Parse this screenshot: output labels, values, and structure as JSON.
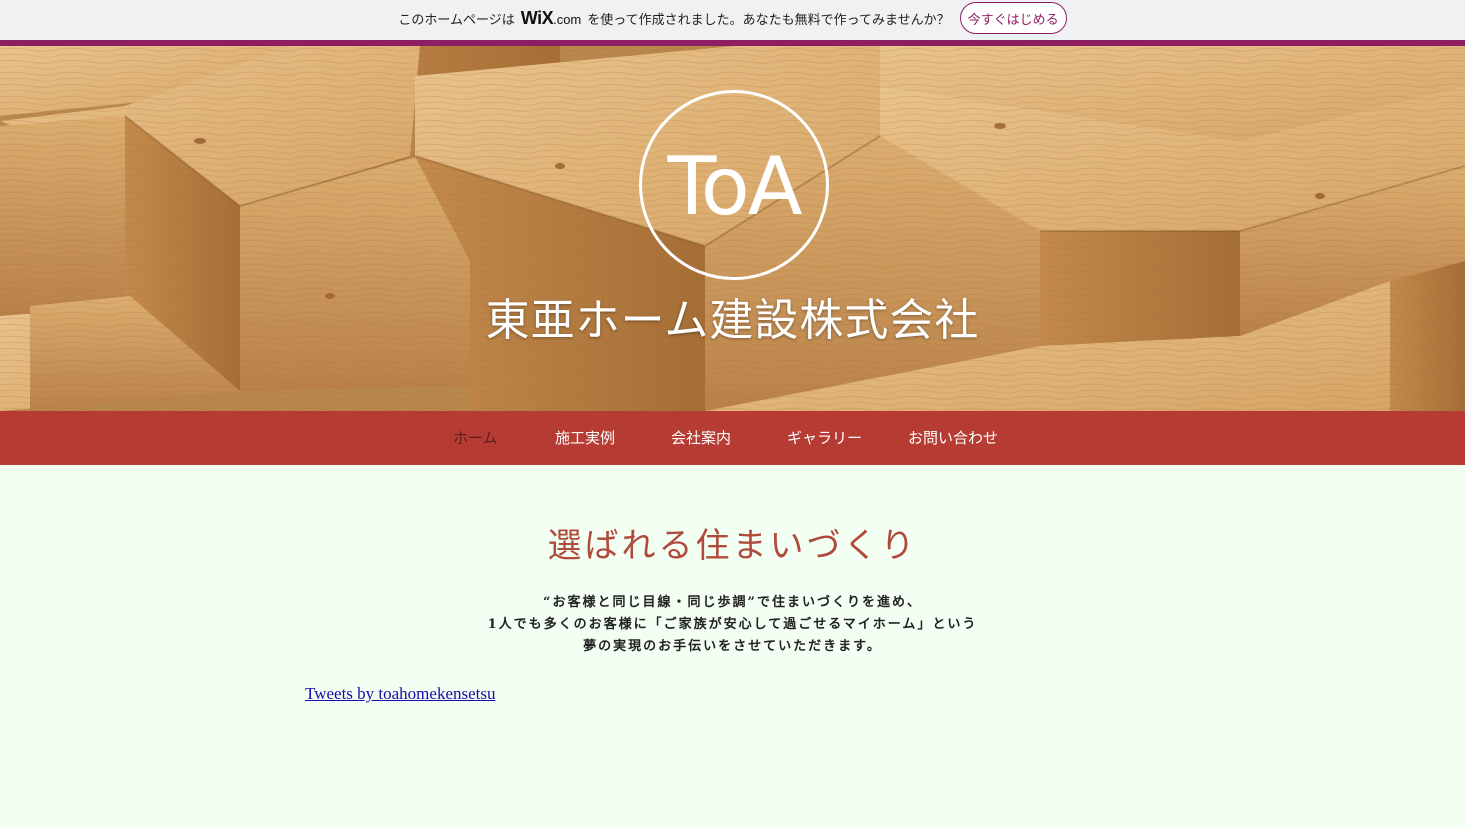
{
  "wix_banner": {
    "text_before": "このホームページは",
    "logo": "WiX",
    "logo_suffix": ".com",
    "text_after": "を使って作成されました。あなたも無料で作ってみませんか？",
    "cta_label": "今すぐはじめる",
    "accent_color": "#8e1e63"
  },
  "hero": {
    "logo_text": "ToA",
    "company_name": "東亜ホーム建設株式会社"
  },
  "nav": {
    "items": [
      {
        "label": "ホーム",
        "active": true
      },
      {
        "label": "施工実例",
        "active": false
      },
      {
        "label": "会社案内",
        "active": false
      },
      {
        "label": "ギャラリー",
        "active": false
      },
      {
        "label": "お問い合わせ",
        "active": false
      }
    ],
    "background_color": "#b63c33"
  },
  "main": {
    "heading": "選ばれる住まいづくり",
    "intro_lines": [
      "“お客様と同じ目線・同じ歩調”で住まいづくりを進め、",
      "1人でも多くのお客様に「ご家族が安心して過ごせるマイホーム」という",
      "夢の実現のお手伝いをさせていただきます。"
    ],
    "tweets_link": "Tweets by toahomekensetsu"
  }
}
